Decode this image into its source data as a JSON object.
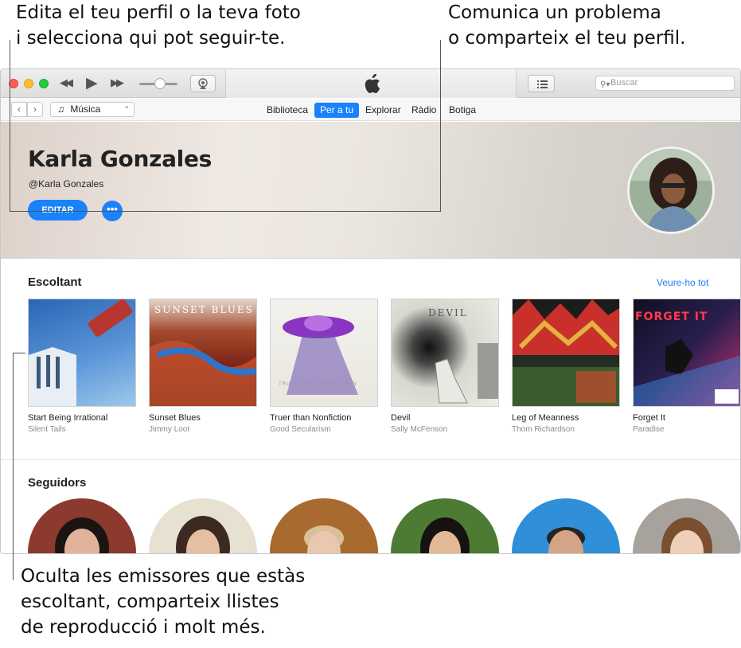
{
  "callouts": {
    "top_left": "Edita el teu perfil o la teva foto\ni selecciona qui pot seguir-te.",
    "top_right": "Comunica un problema\no comparteix el teu perfil.",
    "bottom": "Oculta les emissores que estàs\nescoltant, comparteix llistes\nde reproducció i molt més."
  },
  "toolbar": {
    "search_placeholder": "Buscar",
    "icons": [
      "rewind-icon",
      "play-icon",
      "fast-forward-icon",
      "airplay-icon",
      "apple-logo",
      "list-view-icon",
      "search-icon"
    ]
  },
  "navbar": {
    "media_type": "Música",
    "tabs": [
      "Biblioteca",
      "Per a tu",
      "Explorar",
      "Ràdio",
      "Botiga"
    ],
    "active_tab": "Per a tu"
  },
  "profile": {
    "name": "Karla Gonzales",
    "handle": "@Karla Gonzales",
    "edit_label": "EDITAR",
    "more_label": "•••"
  },
  "listening": {
    "title": "Escoltant",
    "see_all": "Veure-ho tot",
    "albums": [
      {
        "title": "Start Being Irrational",
        "artist": "Silent Tails",
        "art_text": ""
      },
      {
        "title": "Sunset Blues",
        "artist": "Jimmy Loot",
        "art_text": "SUNSET BLUES"
      },
      {
        "title": "Truer than Nonfiction",
        "artist": "Good Secularism",
        "art_text": "TRUER THAN NONFICTION"
      },
      {
        "title": "Devil",
        "artist": "Sally McFenson",
        "art_text": "DEVIL"
      },
      {
        "title": "Leg of Meanness",
        "artist": "Thom Richardson",
        "art_text": ""
      },
      {
        "title": "Forget It",
        "artist": "Paradise",
        "art_text": "FORGET IT"
      }
    ]
  },
  "followers": {
    "title": "Seguidors"
  },
  "colors": {
    "accent": "#1a82fb",
    "close": "#fc5f57",
    "minimize": "#fdbc2e",
    "zoom": "#28c840"
  }
}
